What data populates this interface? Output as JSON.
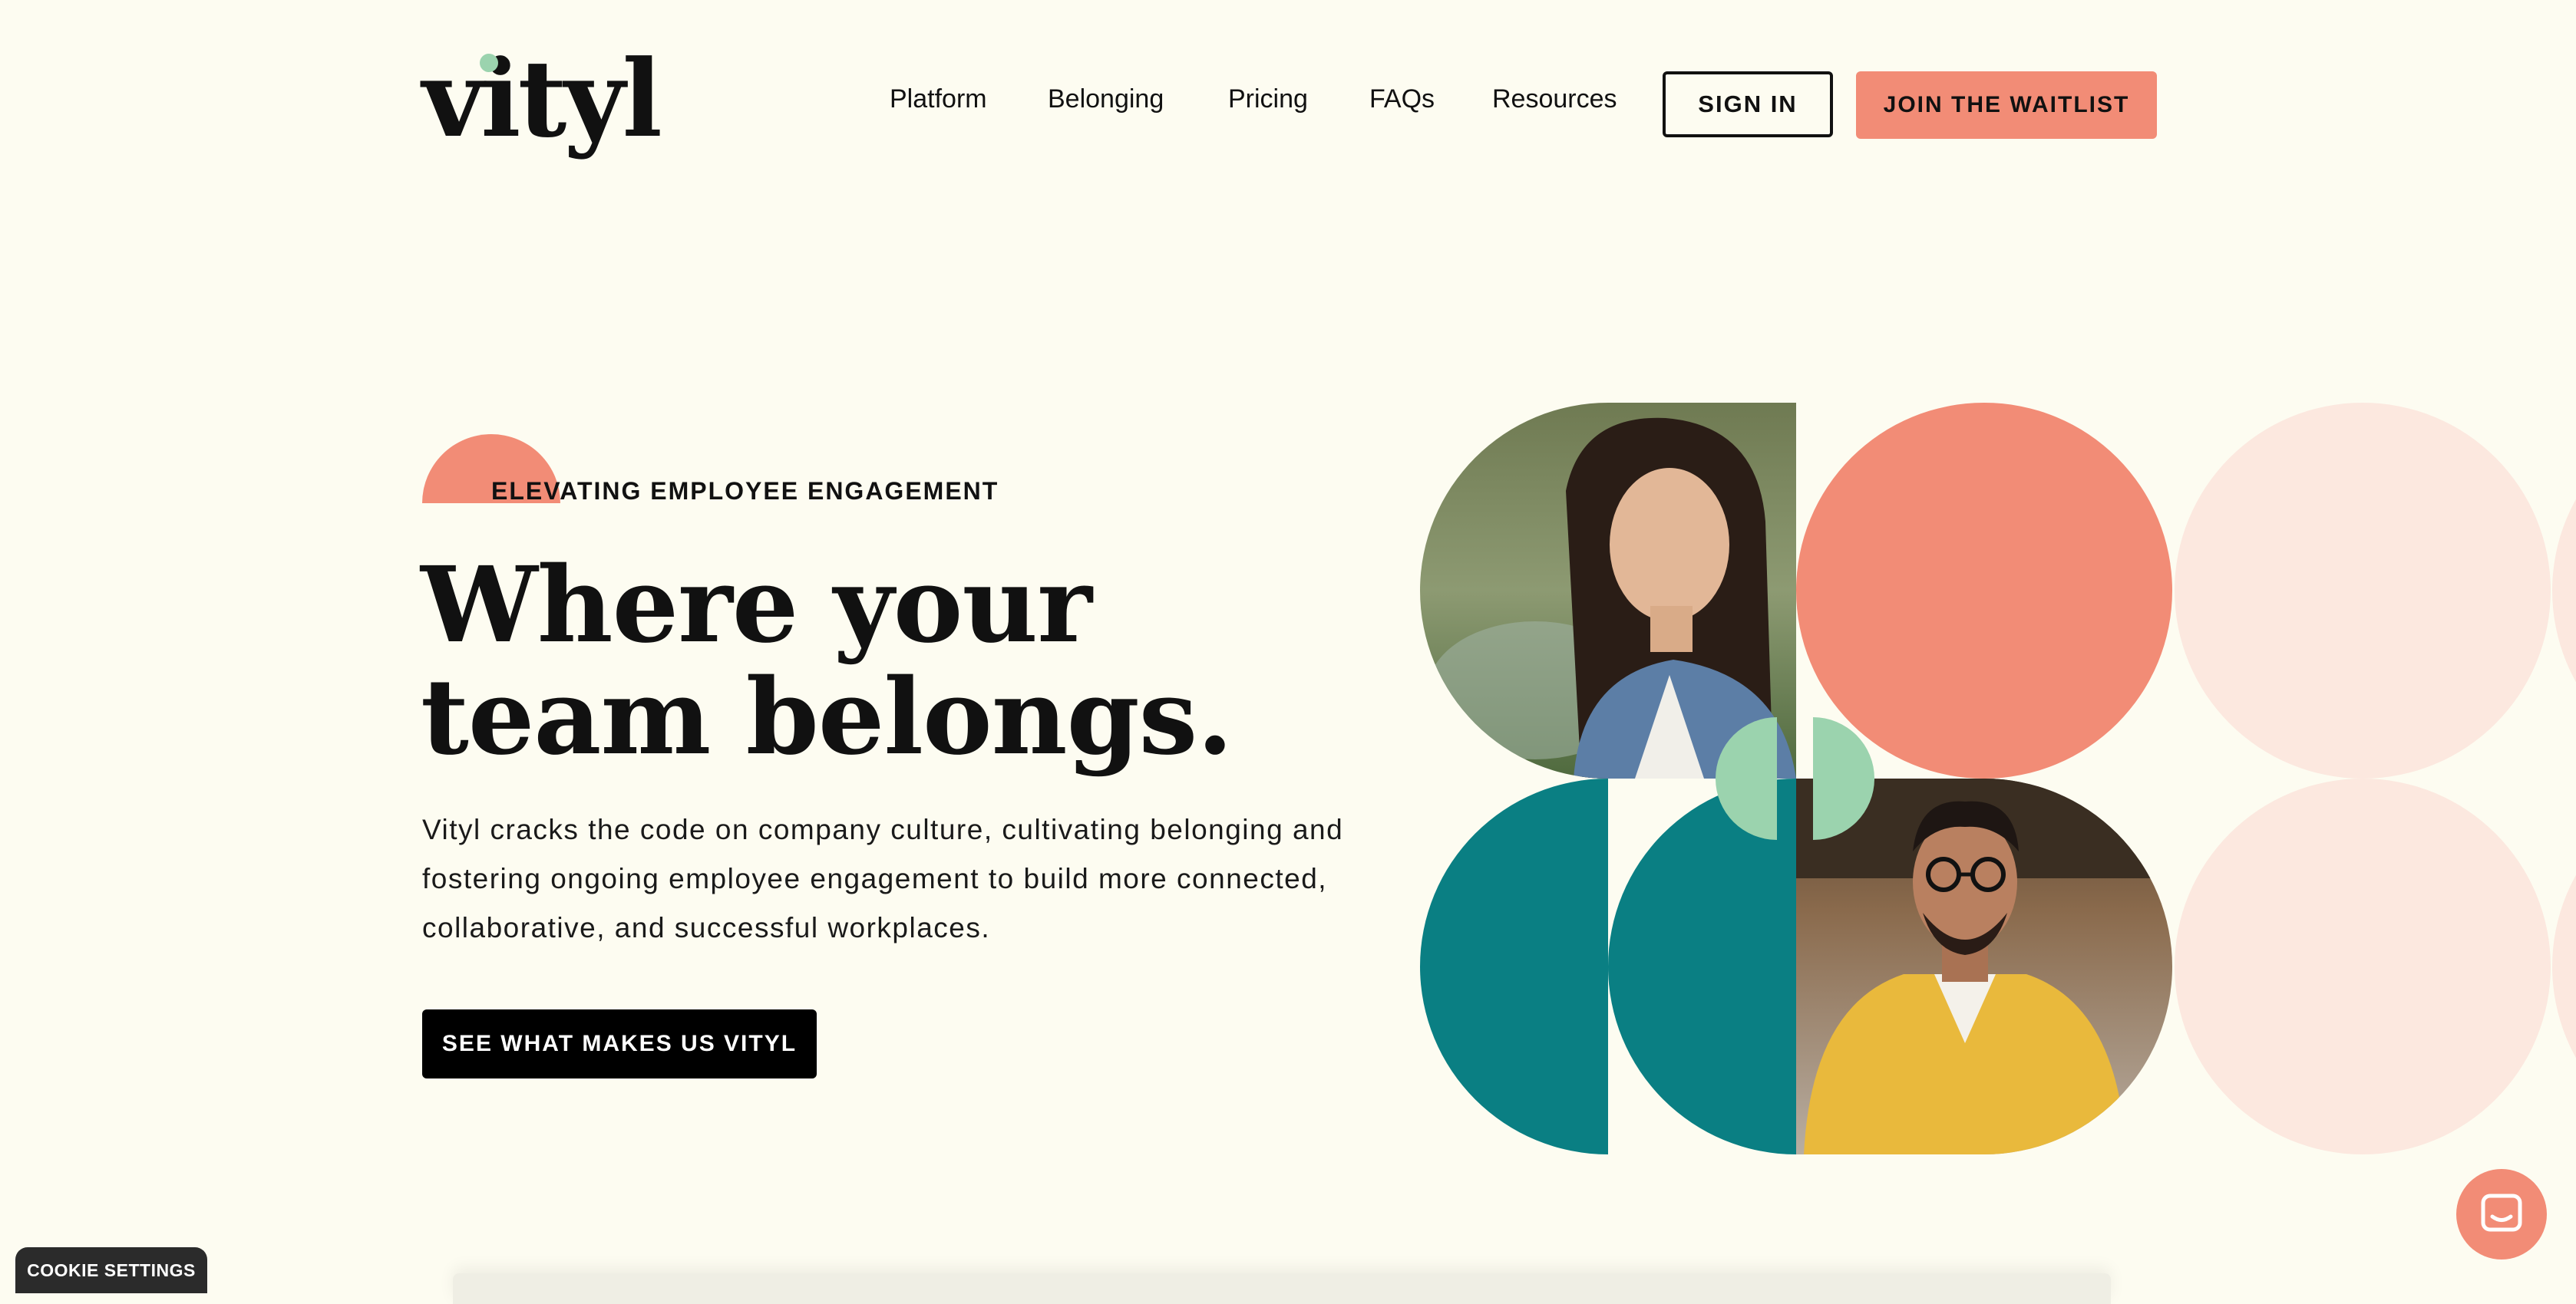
{
  "header": {
    "logo": "vityl",
    "nav": [
      "Platform",
      "Belonging",
      "Pricing",
      "FAQs",
      "Resources"
    ],
    "sign_in": "SIGN IN",
    "join": "JOIN THE WAITLIST"
  },
  "hero": {
    "eyebrow": "ELEVATING EMPLOYEE ENGAGEMENT",
    "headline_line1": "Where your",
    "headline_line2": "team belongs.",
    "body": "Vityl cracks the code on company culture, cultivating belonging and fostering ongoing employee engagement to build more connected, collaborative, and successful workplaces.",
    "cta": "SEE WHAT MAKES US VITYL"
  },
  "footer": {
    "cookie_settings": "COOKIE SETTINGS"
  },
  "colors": {
    "background": "#FDFCF1",
    "coral": "#F28C76",
    "teal": "#0A7F83",
    "mint": "#9BD3AE",
    "pale_pink": "#FCE8DF"
  },
  "icons": [
    "chat-icon"
  ]
}
